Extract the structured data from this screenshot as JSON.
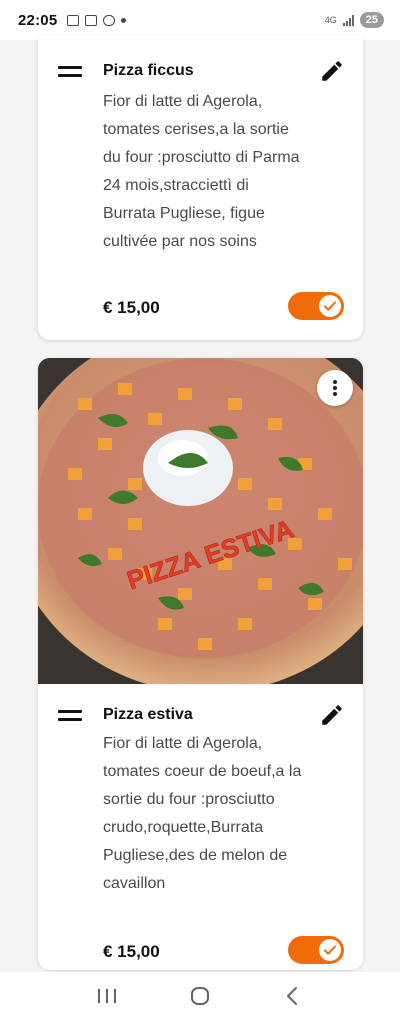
{
  "status_bar": {
    "time": "22:05",
    "network": "4G",
    "battery": "25"
  },
  "items": [
    {
      "title": "Pizza ficcus",
      "description": "Fior di latte di Agerola, tomates cerises,a la sortie du four :prosciutto di Parma 24 mois,stracciettì di Burrata Pugliese, figue cultivée par nos soins",
      "price": "€ 15,00",
      "enabled": true
    },
    {
      "title": "Pizza estiva",
      "description": "Fior di latte di Agerola, tomates coeur de boeuf,a la sortie du four :prosciutto crudo,roquette,Burrata Pugliese,des de melon de cavaillon",
      "price": "€ 15,00",
      "enabled": true,
      "image_overlay_text": "PIZZA ESTIVA"
    }
  ],
  "icons": {
    "drag": "drag-handle-icon",
    "edit": "pencil-icon",
    "more": "more-vertical-icon",
    "toggle_check": "check-icon",
    "nav_recent": "recent-apps-icon",
    "nav_home": "home-icon",
    "nav_back": "back-icon"
  },
  "colors": {
    "accent": "#f26b0a",
    "text_primary": "#111111",
    "text_secondary": "#4a4a4a"
  }
}
